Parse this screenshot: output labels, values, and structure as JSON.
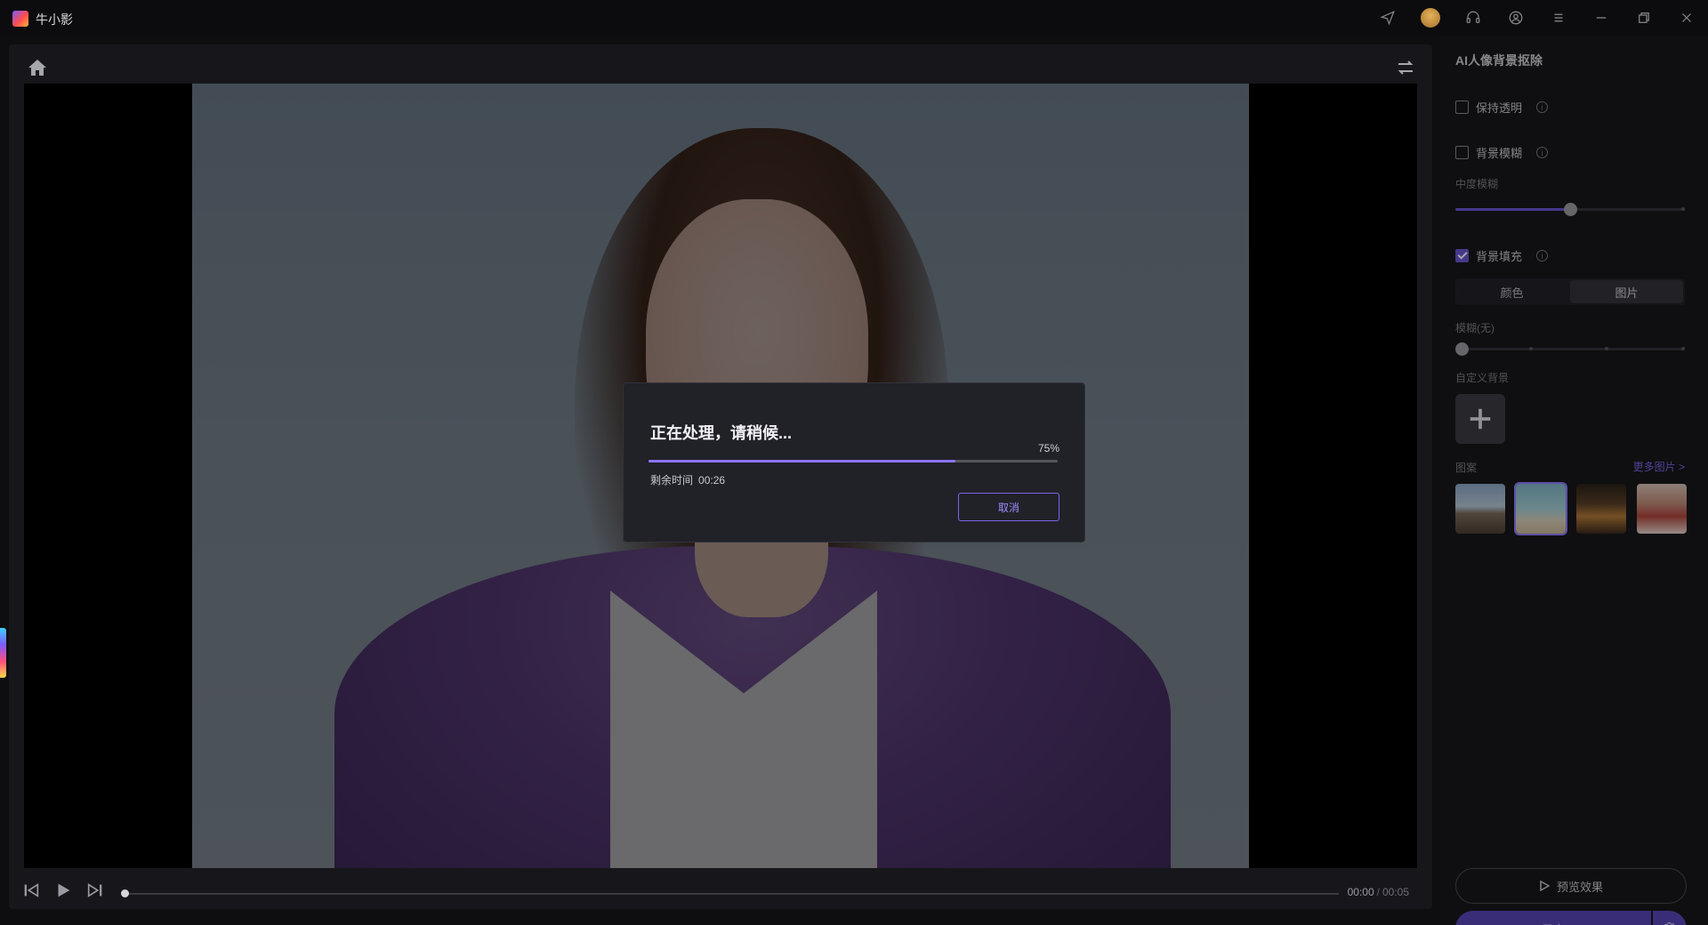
{
  "app": {
    "name": "牛小影"
  },
  "panel": {
    "title": "AI人像背景抠除",
    "keep_transparent": {
      "label": "保持透明",
      "checked": false
    },
    "bg_blur": {
      "label": "背景模糊",
      "checked": false
    },
    "blur_level_label": "中度模糊",
    "blur_level": 0.5,
    "bg_fill": {
      "label": "背景填充",
      "checked": true
    },
    "fill_tabs": [
      "颜色",
      "图片"
    ],
    "fill_active_tab": "图片",
    "fill_blur_label": "模糊(无)",
    "fill_blur_level": 0,
    "custom_bg_label": "自定义背景",
    "pattern_label": "图案",
    "more_images_link": "更多图片 >",
    "thumbnails": [
      {
        "name": "road-landscape",
        "selected": false
      },
      {
        "name": "beach-palm",
        "selected": true
      },
      {
        "name": "cafe-interior",
        "selected": false
      },
      {
        "name": "festive-room",
        "selected": false
      }
    ],
    "preview_button": "预览效果",
    "export_button": "导出"
  },
  "player": {
    "current_time": "00:00",
    "total_time": "00:05",
    "progress": 0
  },
  "dialog": {
    "title": "正在处理，请稍候...",
    "percent_text": "75%",
    "progress": 0.75,
    "remaining_label": "剩余时间",
    "remaining_value": "00:26",
    "cancel_button": "取消"
  },
  "colors": {
    "accent": "#6b56d6",
    "progress_fill": "#8b74ff",
    "export_button": "#5a46b8"
  }
}
